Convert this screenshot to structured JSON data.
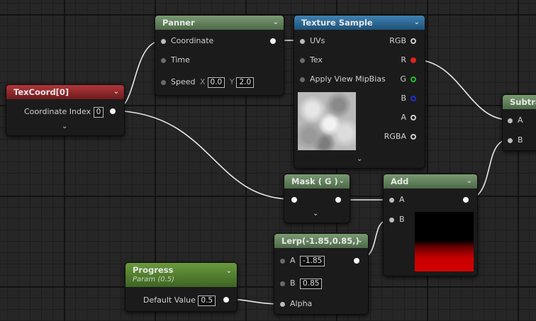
{
  "nodes": {
    "panner": {
      "title": "Panner",
      "pins": {
        "coordinate": "Coordinate",
        "time": "Time",
        "speed": "Speed"
      },
      "speed_x_label": "X",
      "speed_x": "0.0",
      "speed_y_label": "Y",
      "speed_y": "2.0"
    },
    "texture_sample": {
      "title": "Texture Sample",
      "inputs": {
        "uvs": "UVs",
        "tex": "Tex",
        "mip": "Apply View MipBias"
      },
      "outputs": {
        "rgb": "RGB",
        "r": "R",
        "g": "G",
        "b": "B",
        "a": "A",
        "rgba": "RGBA"
      }
    },
    "texcoord": {
      "title": "TexCoord[0]",
      "coord_index_label": "Coordinate Index",
      "coord_index": "0"
    },
    "subtract": {
      "title": "Subtract",
      "a": "A",
      "b": "B"
    },
    "mask": {
      "title": "Mask ( G )"
    },
    "add": {
      "title": "Add",
      "a": "A",
      "b": "B"
    },
    "lerp": {
      "title": "Lerp(-1.85,0.85,)",
      "a_label": "A",
      "a_val": "-1.85",
      "b_label": "B",
      "b_val": "0.85",
      "alpha": "Alpha"
    },
    "progress": {
      "title": "Progress",
      "subtitle": "Param (0.5)",
      "default_label": "Default Value",
      "default_val": "0.5"
    }
  },
  "pin_colors": {
    "r": "#e02020",
    "g": "#20c020",
    "b": "#2030d0",
    "default": "#cfcfcf"
  },
  "icons": {
    "collapse": "chevron-down-icon",
    "expand": "chevron-down-icon"
  }
}
